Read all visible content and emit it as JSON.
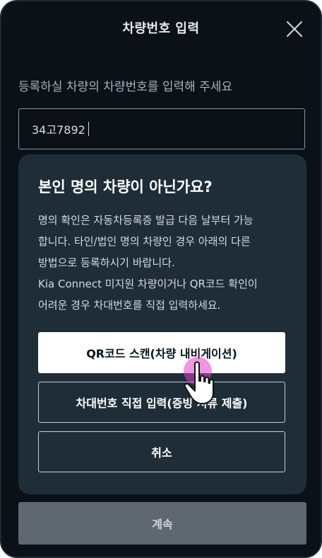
{
  "header": {
    "title": "차량번호 입력",
    "close_icon": "close-icon"
  },
  "form": {
    "instruction": "등록하실 차량의 차량번호를 입력해 주세요",
    "plate_value": "34고7892"
  },
  "sheet": {
    "title": "본인 명의 차량이 아닌가요?",
    "paragraph1": [
      "명의 확인은 자동차등록증 발급 다음 날부터 가능",
      "합니다. 타인/법인 명의 차량인 경우 아래의 다른",
      "방법으로 등록하시기 바랍니다."
    ],
    "paragraph2": [
      "Kia Connect 미지원 차량이거나 QR코드 확인이",
      "어려운 경우 차대번호를 직접 입력하세요."
    ],
    "buttons": {
      "qr_scan": "QR코드 스캔(차량 내비게이션)",
      "vin_input": "차대번호 직접 입력(증빙 서류 제출)",
      "cancel": "취소"
    }
  },
  "footer": {
    "continue_label": "계속"
  },
  "colors": {
    "background": "#0b1117",
    "sheet": "#1f2d38",
    "cursor_highlight": "#e040c8",
    "continue_disabled": "#5f6870"
  }
}
